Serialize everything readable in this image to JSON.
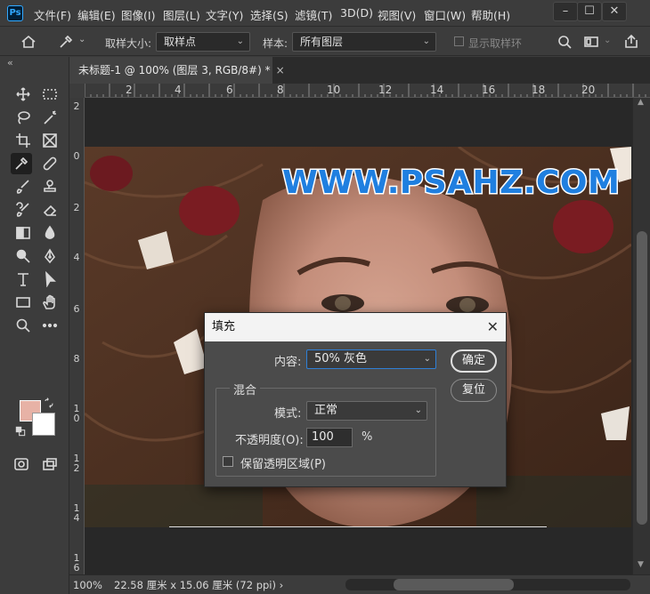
{
  "app": {
    "logo": "Ps"
  },
  "menu": [
    "文件(F)",
    "编辑(E)",
    "图像(I)",
    "图层(L)",
    "文字(Y)",
    "选择(S)",
    "滤镜(T)",
    "3D(D)",
    "视图(V)",
    "窗口(W)",
    "帮助(H)"
  ],
  "window_controls": {
    "minimize": "–",
    "maximize": "☐",
    "close": "✕"
  },
  "options": {
    "sample_size_label": "取样大小:",
    "sample_size_value": "取样点",
    "sample_label": "样本:",
    "sample_value": "所有图层",
    "show_ring_label": "显示取样环"
  },
  "document": {
    "tab_title": "未标题-1 @ 100% (图层 3, RGB/8#) *",
    "tab_close": "×",
    "watermark": "WWW.PSAHZ.COM"
  },
  "ruler": {
    "top": [
      "2",
      "4",
      "6",
      "8",
      "10",
      "12",
      "14",
      "16",
      "18",
      "20"
    ],
    "left": [
      "2",
      "0",
      "2",
      "4",
      "6",
      "8",
      "10",
      "12",
      "14",
      "16"
    ]
  },
  "status": {
    "zoom": "100%",
    "doc_size": "22.58 厘米 x 15.06 厘米 (72 ppi)",
    "arrow": "›"
  },
  "colors": {
    "foreground": "#e7b2a6",
    "background": "#ffffff",
    "accent": "#2f7fd6"
  },
  "fill_dialog": {
    "title": "填充",
    "close": "✕",
    "content_label": "内容:",
    "content_value": "50% 灰色",
    "ok_label": "确定",
    "reset_label": "复位",
    "blend_legend": "混合",
    "mode_label": "模式:",
    "mode_value": "正常",
    "opacity_label": "不透明度(O):",
    "opacity_value": "100",
    "opacity_unit": "%",
    "preserve_label": "保留透明区域(P)",
    "preserve_checked": false
  },
  "icons": [
    "move-icon",
    "marquee-icon",
    "lasso-icon",
    "magic-wand-icon",
    "crop-icon",
    "frame-icon",
    "eyedropper-icon",
    "healing-icon",
    "brush-icon",
    "stamp-icon",
    "history-brush-icon",
    "eraser-icon",
    "gradient-icon",
    "blur-icon",
    "dodge-icon",
    "pen-icon",
    "type-icon",
    "path-select-icon",
    "rectangle-icon",
    "hand-icon",
    "zoom-icon",
    "more-icon",
    "quick-mask-icon",
    "screen-mode-icon",
    "search-icon",
    "workspace-icon",
    "share-icon",
    "home-icon"
  ]
}
